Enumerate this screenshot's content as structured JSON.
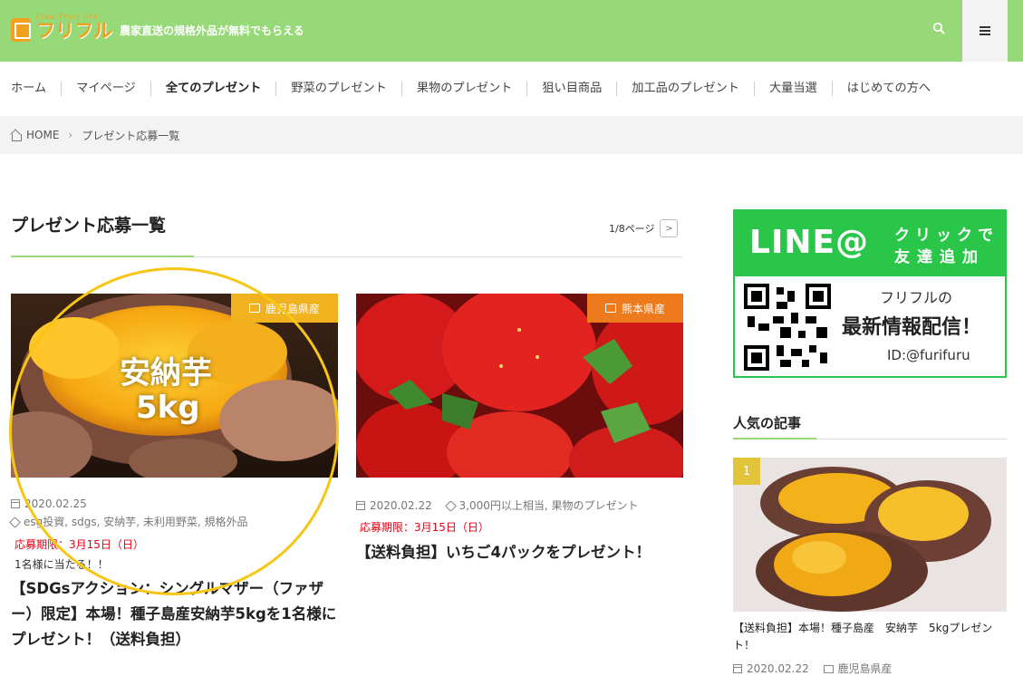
{
  "header": {
    "logo_small": "Free Fruit life",
    "logo_text": "フリフル",
    "tagline": "農家直送の規格外品が無料でもらえる"
  },
  "nav": {
    "items": [
      "ホーム",
      "マイページ",
      "全てのプレゼント",
      "野菜のプレゼント",
      "果物のプレゼント",
      "狙い目商品",
      "加工品のプレゼント",
      "大量当選",
      "はじめての方へ"
    ]
  },
  "breadcrumb": {
    "home": "HOME",
    "current": "プレゼント応募一覧"
  },
  "main": {
    "title": "プレゼント応募一覧",
    "pager": "1/8ページ",
    "pager_next": ">"
  },
  "posts": [
    {
      "category": "鹿児島県産",
      "category_color": "#f0b21f",
      "image_text_1": "安納芋",
      "image_text_2": "5kg",
      "date": "2020.02.25",
      "tags": "esg投資, sdgs, 安納芋, 未利用野菜, 規格外品",
      "deadline": "応募期限：3月15日（日）",
      "winners": "1名様に当たる！！",
      "title": "【SDGsアクション：シングルマザー（ファザー）限定】本場！種子島産安納芋5kgを1名様にプレゼント！（送料負担）"
    },
    {
      "category": "熊本県産",
      "category_color": "#ee7a1e",
      "date": "2020.02.22",
      "tags": "3,000円以上相当, 果物のプレゼント",
      "deadline": "応募期限：3月15日（日）",
      "title": "【送料負担】いちご4パックをプレゼント！"
    }
  ],
  "sidebar": {
    "line_logo": "LINE@",
    "line_t1": "クリックで",
    "line_t2": "友達追加",
    "line_l1": "フリフルの",
    "line_l2": "最新情報配信！",
    "line_l3": "ID:@furifuru",
    "popular_title": "人気の記事",
    "popular": {
      "rank": "1",
      "title": "【送料負担】本場！種子島産　安納芋　5kgプレゼント！",
      "date": "2020.02.22",
      "category": "鹿児島県産"
    }
  },
  "colors": {
    "header": "#97d979",
    "line_green": "#2ac64a",
    "deadline": "#e60012",
    "highlight": "#f7c614"
  }
}
